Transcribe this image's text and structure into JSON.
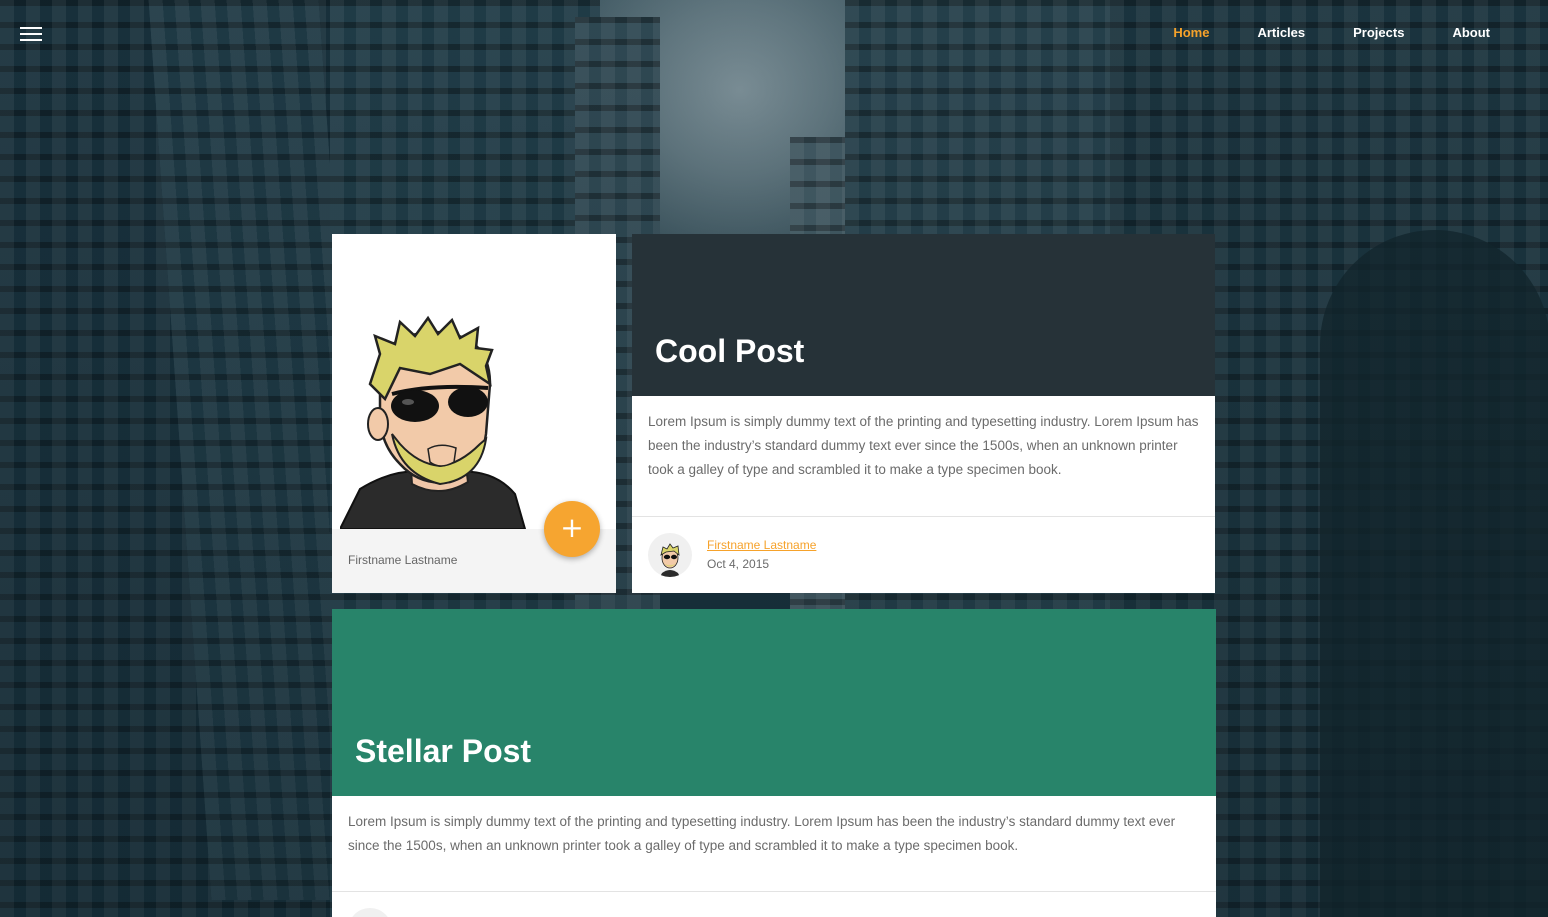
{
  "nav": {
    "menu_icon": "hamburger-menu-icon",
    "links": [
      "Home",
      "Articles",
      "Projects",
      "About"
    ],
    "active": "Home",
    "accent_color": "#f6a22b"
  },
  "profile": {
    "name": "Firstname Lastname",
    "fab_symbol": "+",
    "fab_icon": "plus-icon",
    "fab_color": "#f6a530"
  },
  "posts": [
    {
      "title": "Cool Post",
      "header_color": "#263238",
      "body": "Lorem Ipsum is simply dummy text of the printing and typesetting industry. Lorem Ipsum has been the industry’s standard dummy text ever since the 1500s, when an unknown printer took a galley of type and scrambled it to make a type specimen book.",
      "author": "Firstname Lastname",
      "date": "Oct 4, 2015"
    },
    {
      "title": "Stellar Post",
      "header_color": "#28846a",
      "body": "Lorem Ipsum is simply dummy text of the printing and typesetting industry. Lorem Ipsum has been the industry’s standard dummy text ever since the 1500s, when an unknown printer took a galley of type and scrambled it to make a type specimen book."
    }
  ]
}
